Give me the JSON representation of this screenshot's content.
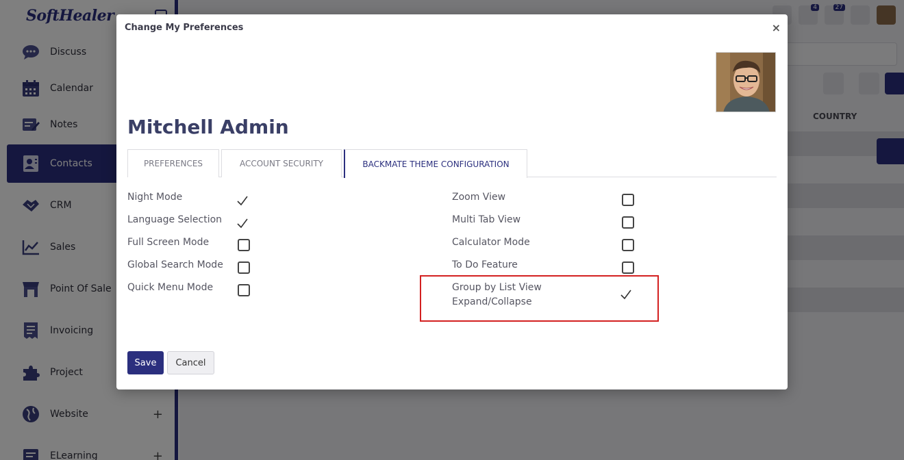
{
  "app": {
    "logo": "SoftHealer"
  },
  "sidebar": {
    "items": [
      {
        "label": "Discuss",
        "icon": "discuss-icon"
      },
      {
        "label": "Calendar",
        "icon": "calendar-icon"
      },
      {
        "label": "Notes",
        "icon": "notes-icon"
      },
      {
        "label": "Contacts",
        "icon": "contacts-icon",
        "active": true
      },
      {
        "label": "CRM",
        "icon": "crm-icon"
      },
      {
        "label": "Sales",
        "icon": "sales-icon"
      },
      {
        "label": "Point Of Sale",
        "icon": "point-of-sale-icon"
      },
      {
        "label": "Invoicing",
        "icon": "invoicing-icon"
      },
      {
        "label": "Project",
        "icon": "project-icon"
      },
      {
        "label": "Website",
        "icon": "website-icon",
        "expandable": true
      },
      {
        "label": "ELearning",
        "icon": "elearning-icon",
        "expandable": true
      }
    ],
    "plus_glyph": "+"
  },
  "topbar": {
    "messages_badge": "4",
    "activities_badge": "27"
  },
  "list": {
    "country_header": "COUNTRY"
  },
  "modal": {
    "title": "Change My Preferences",
    "close_glyph": "×",
    "user_name": "Mitchell Admin",
    "tabs": [
      {
        "label": "PREFERENCES"
      },
      {
        "label": "ACCOUNT SECURITY"
      },
      {
        "label": "BACKMATE THEME CONFIGURATION",
        "active": true
      }
    ],
    "left_options": [
      {
        "label": "Night Mode",
        "checked": true
      },
      {
        "label": "Language Selection",
        "checked": true
      },
      {
        "label": "Full Screen Mode",
        "checked": false
      },
      {
        "label": "Global Search Mode",
        "checked": false
      },
      {
        "label": "Quick Menu Mode",
        "checked": false
      }
    ],
    "right_options": [
      {
        "label": "Zoom View",
        "checked": false
      },
      {
        "label": "Multi Tab View",
        "checked": false
      },
      {
        "label": "Calculator Mode",
        "checked": false
      },
      {
        "label": "To Do Feature",
        "checked": false
      },
      {
        "label": "Group by List View Expand/Collapse",
        "label_line1": "Group by List View",
        "label_line2": "Expand/Collapse",
        "checked": true
      }
    ],
    "save_label": "Save",
    "cancel_label": "Cancel"
  },
  "colors": {
    "primary": "#2b2f7e",
    "highlight": "#d32020"
  }
}
